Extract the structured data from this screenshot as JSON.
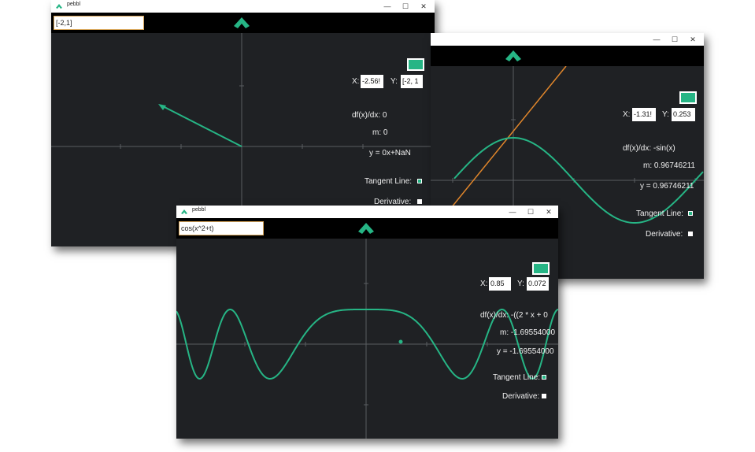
{
  "app": {
    "title": "pebbl",
    "minimize_glyph": "—",
    "maximize_glyph": "☐",
    "close_glyph": "✕"
  },
  "colors": {
    "accent": "#26b585",
    "background": "#1f2124",
    "toolbar": "#000000",
    "axis": "#5a5d61",
    "tangent": "#e0862b"
  },
  "windows": {
    "w1": {
      "function_input": "[-2,1]",
      "x_label": "X:",
      "x_value": "-2.56!",
      "y_label": "Y:",
      "y_value": "[-2, 1",
      "derivative_text": "df(x)/dx: 0",
      "slope_text": "m: 0",
      "tangent_eq_text": "y = 0x+NaN",
      "tangent_line_label": "Tangent Line:",
      "derivative_label": "Derivative:"
    },
    "w2": {
      "x_label": "X:",
      "x_value": "-1.31!",
      "y_label": "Y:",
      "y_value": "0.253",
      "derivative_text": "df(x)/dx: -sin(x)",
      "slope_text": "m: 0.96746211",
      "tangent_eq_text": "y = 0.96746211",
      "tangent_line_label": "Tangent Line:",
      "derivative_label": "Derivative:"
    },
    "w3": {
      "function_input": "cos(x^2+t)",
      "x_label": "X:",
      "x_value": "0.85",
      "y_label": "Y:",
      "y_value": "0.072",
      "derivative_text": "df(x)/dx: -((2 * x + 0",
      "slope_text": "m: -1.69554000",
      "tangent_eq_text": "y = -1.69554000",
      "tangent_line_label": "Tangent Line:",
      "derivative_label": "Derivative:"
    }
  }
}
